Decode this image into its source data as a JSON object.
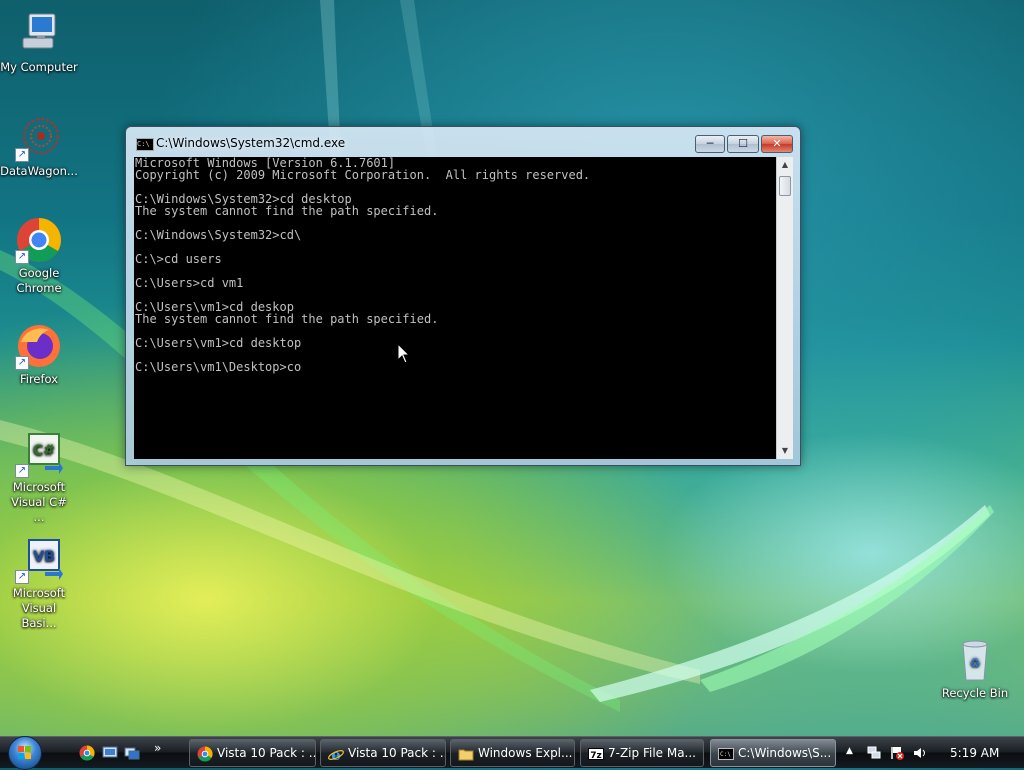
{
  "desktop": {
    "icons": [
      {
        "label": "My Computer",
        "icon": "computer-icon"
      },
      {
        "label": "DataWagon...",
        "icon": "datawagon-icon"
      },
      {
        "label": "Google Chrome",
        "icon": "chrome-icon"
      },
      {
        "label": "Firefox",
        "icon": "firefox-icon"
      },
      {
        "label": "Microsoft Visual C# ...",
        "icon": "visual-csharp-icon"
      },
      {
        "label": "Microsoft Visual Basi...",
        "icon": "visual-basic-icon"
      },
      {
        "label": "Recycle Bin",
        "icon": "recycle-bin-icon"
      }
    ]
  },
  "cmd": {
    "title": "C:\\Windows\\System32\\cmd.exe",
    "buttons": {
      "minimize": "─",
      "maximize": "☐",
      "close": "✕"
    },
    "lines": [
      "Microsoft Windows [Version 6.1.7601]",
      "Copyright (c) 2009 Microsoft Corporation.  All rights reserved.",
      "",
      "C:\\Windows\\System32>cd desktop",
      "The system cannot find the path specified.",
      "",
      "C:\\Windows\\System32>cd\\",
      "",
      "C:\\>cd users",
      "",
      "C:\\Users>cd vm1",
      "",
      "C:\\Users\\vm1>cd deskop",
      "The system cannot find the path specified.",
      "",
      "C:\\Users\\vm1>cd desktop",
      "",
      "C:\\Users\\vm1\\Desktop>co"
    ]
  },
  "taskbar": {
    "quicklaunch_more": "»",
    "tasks": [
      {
        "label": "Vista 10 Pack : ...",
        "icon": "chrome-icon"
      },
      {
        "label": "Vista 10 Pack : ...",
        "icon": "ie-icon"
      },
      {
        "label": "Windows Expl...",
        "icon": "explorer-icon"
      },
      {
        "label": "7-Zip File Ma...",
        "icon": "7zip-icon"
      },
      {
        "label": "C:\\Windows\\S...",
        "icon": "cmd-icon"
      }
    ],
    "tray_expand": "▲",
    "clock": "5:19 AM"
  },
  "colors": {
    "console_bg": "#000000",
    "console_text": "#c0c0c0",
    "close_button": "#c7382a"
  }
}
